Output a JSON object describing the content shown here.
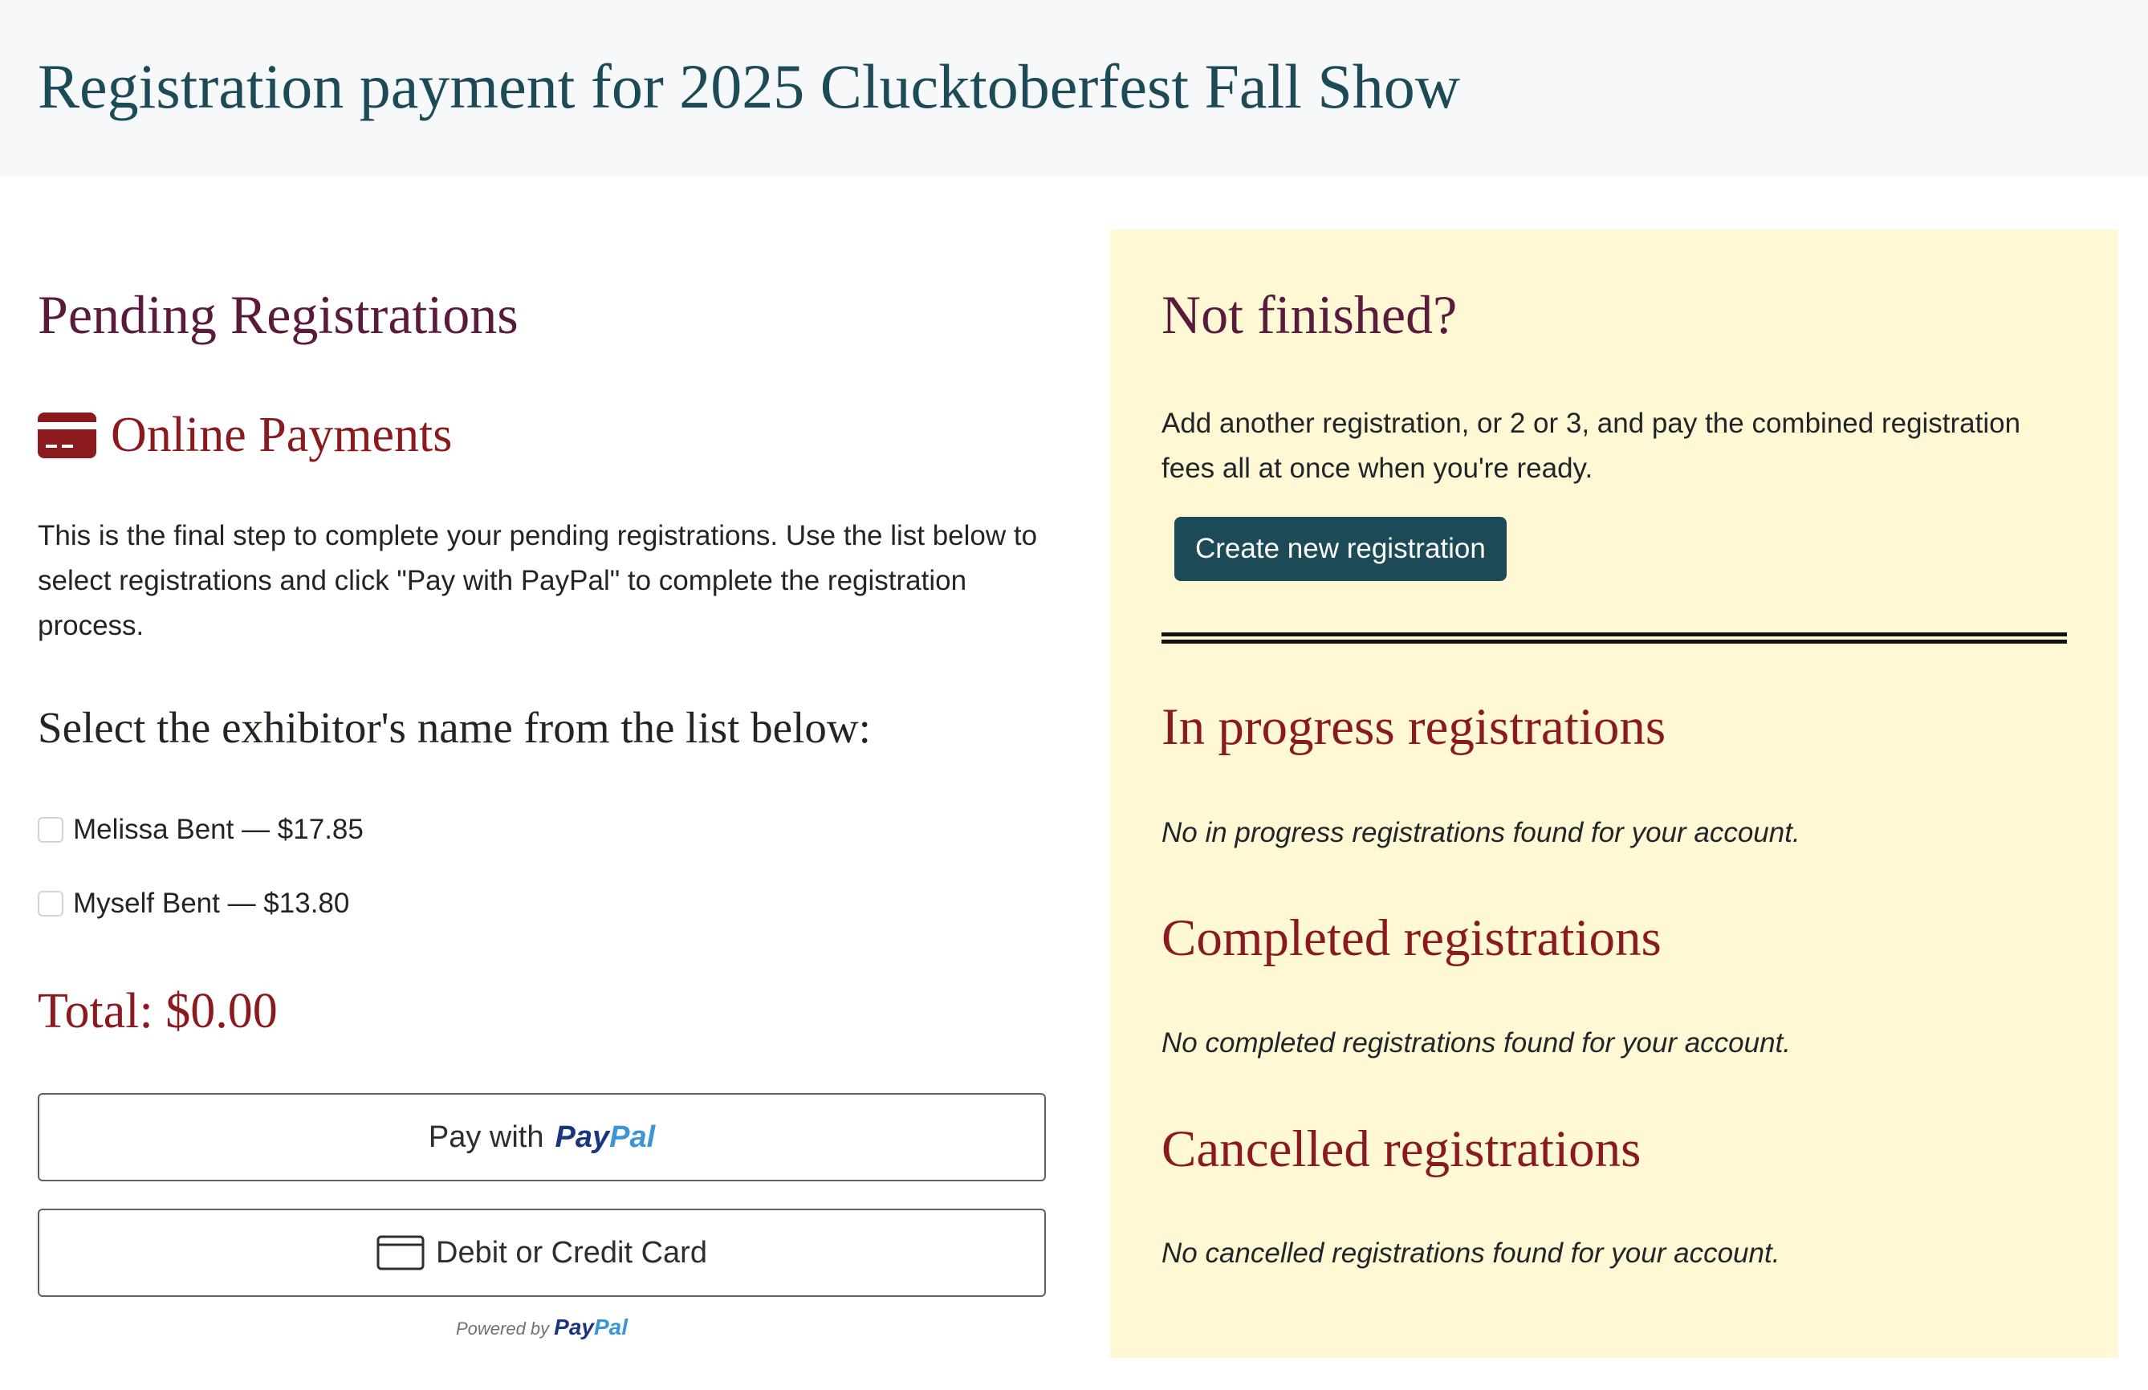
{
  "header": {
    "title": "Registration payment for 2025 Clucktoberfest Fall Show"
  },
  "pending": {
    "title": "Pending Registrations",
    "online_payments": {
      "icon": "credit-card-icon",
      "label": "Online Payments"
    },
    "intro": "This is the final step to complete your pending registrations. Use the list below to select registrations and click \"Pay with PayPal\" to complete the registration process.",
    "select_prompt": "Select the exhibitor's name from the list below:",
    "registrations": [
      {
        "label": "Melissa Bent — $17.85",
        "checked": false
      },
      {
        "label": "Myself Bent — $13.80",
        "checked": false
      }
    ],
    "total": "Total: $0.00",
    "paypal_button": {
      "prefix": "Pay with",
      "brand_part1": "Pay",
      "brand_part2": "Pal"
    },
    "card_button": {
      "icon": "credit-card-outline-icon",
      "label": "Debit or Credit Card"
    },
    "powered_by": {
      "prefix": "Powered by",
      "brand_part1": "Pay",
      "brand_part2": "Pal"
    }
  },
  "side_panel": {
    "not_finished_title": "Not finished?",
    "description": "Add another registration, or 2 or 3, and pay the combined registration fees all at once when you're ready.",
    "create_button": "Create new registration",
    "in_progress": {
      "title": "In progress registrations",
      "empty": "No in progress registrations found for your account."
    },
    "completed": {
      "title": "Completed registrations",
      "empty": "No completed registrations found for your account."
    },
    "cancelled": {
      "title": "Cancelled registrations",
      "empty": "No cancelled registrations found for your account."
    }
  },
  "colors": {
    "header_title": "#1c4a57",
    "accent_red": "#8b1a1f",
    "section_purple": "#5a1a3c",
    "side_panel_bg": "#fef9d4",
    "primary_button": "#1c4a57",
    "paypal_dark": "#1a3580",
    "paypal_light": "#3a96d6"
  }
}
